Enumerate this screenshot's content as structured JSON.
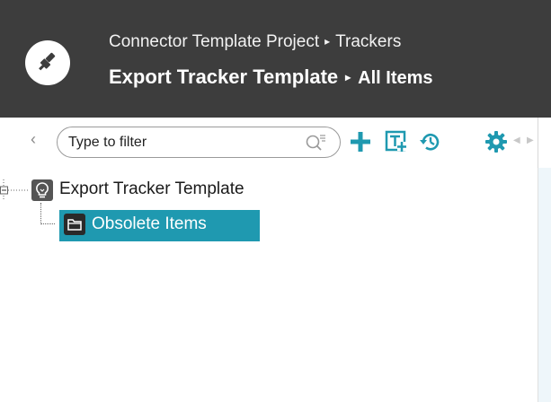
{
  "header": {
    "project": "Connector Template Project",
    "section": "Trackers",
    "title": "Export Tracker Template",
    "view": "All Items",
    "separator": "▸"
  },
  "toolbar": {
    "back_symbol": "‹",
    "filter_placeholder": "Type to filter",
    "filter_value": "",
    "icons": [
      "add-icon",
      "new-item-icon",
      "history-icon",
      "settings-icon"
    ],
    "accent_color": "#1f99b0"
  },
  "tree": {
    "root": {
      "label": "Export Tracker Template",
      "icon": "lightbulb-icon"
    },
    "children": [
      {
        "label": "Obsolete Items",
        "icon": "folder-icon",
        "selected": true
      }
    ]
  }
}
